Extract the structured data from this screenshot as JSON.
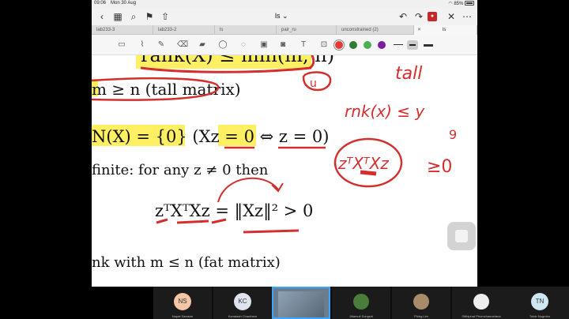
{
  "status": {
    "time": "09:06",
    "date": "Mon 30 Aug",
    "battery": "85%"
  },
  "navbar": {
    "title": "ls",
    "record_badge": "●"
  },
  "tabs": [
    {
      "label": "lab233-3"
    },
    {
      "label": "lab233-2"
    },
    {
      "label": "ls"
    },
    {
      "label": "pair_ru"
    },
    {
      "label": "unconstrained (2)"
    },
    {
      "label": "ls"
    }
  ],
  "toolbar": {
    "colors": {
      "red": "#e53935",
      "green": "#2e7d32",
      "lightgreen": "#4caf50",
      "purple": "#7b1fa2",
      "blue": "#1565c0"
    }
  },
  "canvas": {
    "line1_text": "rank(X) ≤ min(m, n)",
    "line2_text": "m ≥ n (tall matrix)",
    "line3_text": "N(X) = {0} (Xz = 0 ⇔ z = 0)",
    "line4_text": "finite:  for any z ≠ 0 then",
    "line5_text": "zᵀXᵀXz = ‖Xz‖² > 0",
    "line6_text": "nk with m ≤ n (fat matrix)",
    "handwritten": {
      "word1": "tall",
      "word2": "rnk(x) ≤ y",
      "word3": "zᵀXᵀXz",
      "word4": "≥0",
      "word5": "u",
      "word6": "9"
    }
  },
  "participants": [
    {
      "initials": "NS",
      "name": "Napat Samsee",
      "color": "#f5c6a5"
    },
    {
      "initials": "KC",
      "name": "Kanatash Chanthem",
      "color": "#dfe3f0"
    },
    {
      "initials": "",
      "name": "",
      "color": ""
    },
    {
      "initials": "",
      "name": "Jiitamuil Songsiri",
      "color": ""
    },
    {
      "initials": "",
      "name": "Phing Lim",
      "color": ""
    },
    {
      "initials": "",
      "name": "Sitthiphat Phomchaeoetana",
      "color": ""
    },
    {
      "initials": "TN",
      "name": "Totob Nugroho",
      "color": "#cfe6f3"
    }
  ]
}
